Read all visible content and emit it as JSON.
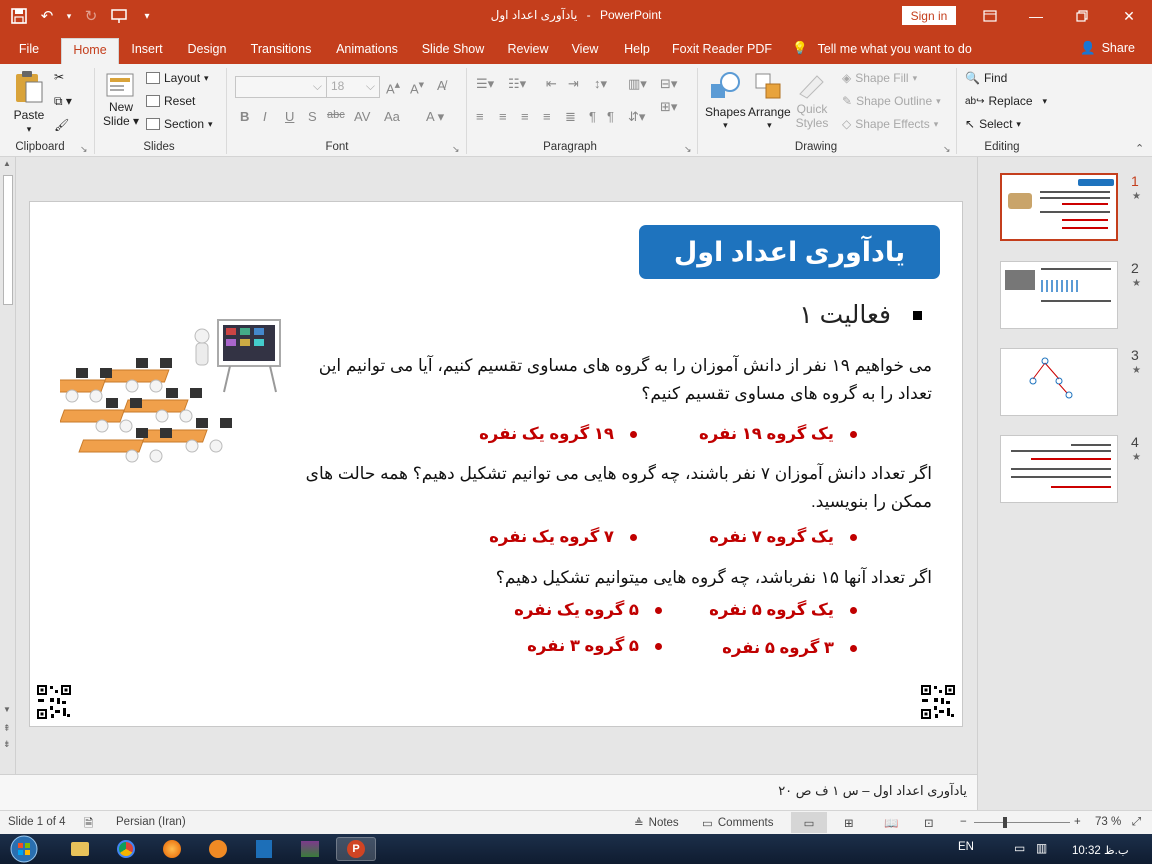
{
  "titlebar": {
    "doc_name": "یادآوری اعداد اول",
    "separator": "-",
    "app_name": "PowerPoint",
    "signin_label": "Sign in"
  },
  "tabs": [
    "File",
    "Home",
    "Insert",
    "Design",
    "Transitions",
    "Animations",
    "Slide Show",
    "Review",
    "View",
    "Help",
    "Foxit Reader PDF"
  ],
  "active_tab": "Home",
  "tellme": "Tell me what you want to do",
  "share": "Share",
  "ribbon": {
    "clipboard": {
      "label": "Clipboard",
      "paste": "Paste"
    },
    "slides": {
      "label": "Slides",
      "new_slide": "New",
      "new_slide2": "Slide",
      "layout": "Layout",
      "reset": "Reset",
      "section": "Section"
    },
    "font": {
      "label": "Font",
      "font_size": "18"
    },
    "paragraph": {
      "label": "Paragraph"
    },
    "drawing": {
      "label": "Drawing",
      "shapes": "Shapes",
      "arrange": "Arrange",
      "quick_styles": "Quick",
      "quick_styles2": "Styles",
      "shape_fill": "Shape Fill",
      "shape_outline": "Shape Outline",
      "shape_effects": "Shape Effects"
    },
    "editing": {
      "label": "Editing",
      "find": "Find",
      "replace": "Replace",
      "select": "Select"
    }
  },
  "slide": {
    "title": "یادآوری اعداد اول",
    "heading": "فعالیت ۱",
    "q1": "می خواهیم ۱۹ نفر از دانش آموزان را به گروه های مساوی تقسیم کنیم، آیا می توانیم این تعداد را به گروه های مساوی تقسیم کنیم؟",
    "a1_1": "یک گروه ۱۹ نفره",
    "a1_2": "۱۹ گروه یک نفره",
    "q2": "اگر تعداد دانش آموزان ۷ نفر باشند، چه گروه هایی می توانیم تشکیل دهیم؟ همه حالت های ممکن را بنویسید.",
    "a2_1": "یک گروه ۷ نفره",
    "a2_2": "۷ گروه یک نفره",
    "q3": "اگر تعداد آنها ۱۵ نفرباشد، چه گروه هایی میتوانیم تشکیل دهیم؟",
    "a3_1": "یک گروه ۵ نفره",
    "a3_2": "۵ گروه یک نفره",
    "a3_3": "۳ گروه ۵ نفره",
    "a3_4": "۵ گروه ۳ نفره"
  },
  "notes_text": "یادآوری اعداد اول – س ۱ ف ص ۲۰",
  "thumbnails": [
    {
      "num": "1",
      "star": "★"
    },
    {
      "num": "2",
      "star": "★"
    },
    {
      "num": "3",
      "star": "★"
    },
    {
      "num": "4",
      "star": "★"
    }
  ],
  "status": {
    "slide_info": "Slide 1 of 4",
    "language": "Persian (Iran)",
    "notes": "Notes",
    "comments": "Comments",
    "zoom": "73 %"
  },
  "taskbar": {
    "lang": "EN",
    "time": "10:32 ب.ظ"
  },
  "colors": {
    "accent": "#c43e1c",
    "title_box": "#1e73be",
    "answer": "#c00000"
  }
}
